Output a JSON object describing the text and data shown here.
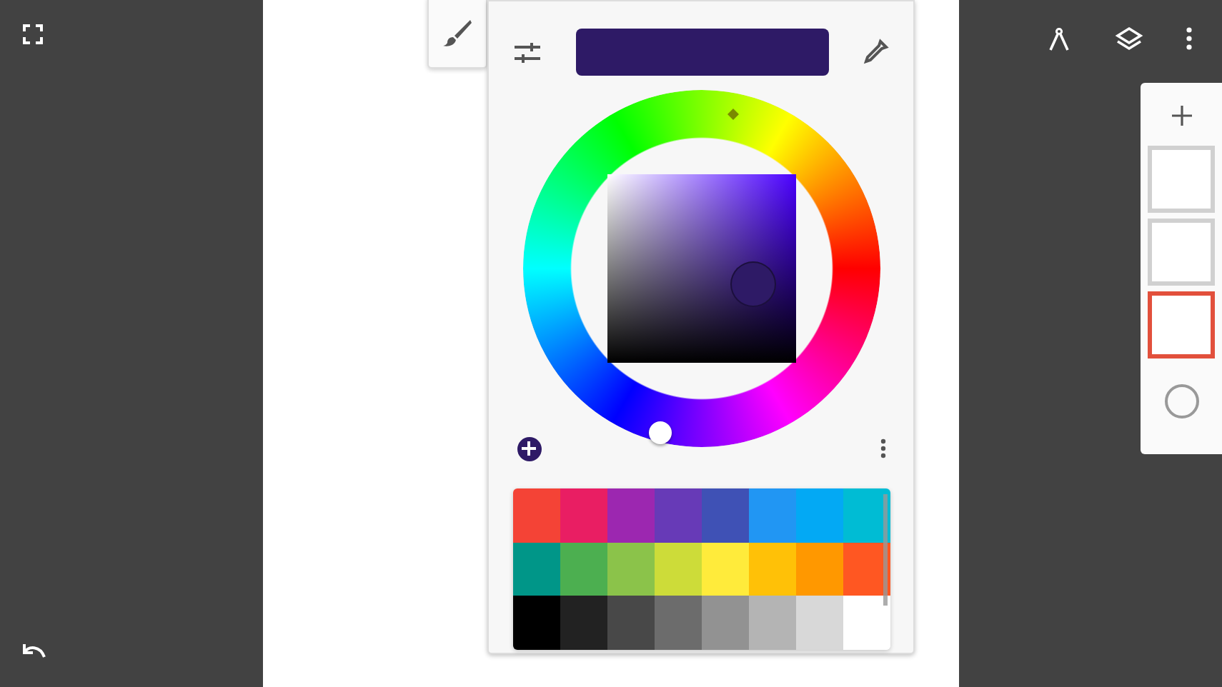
{
  "color_picker": {
    "current_color": {
      "color": "#2e1a66"
    },
    "hue": {
      "color": "#4a00ff"
    },
    "swatches": [
      {
        "color": "#f44336"
      },
      {
        "color": "#e91e63"
      },
      {
        "color": "#9c27b0"
      },
      {
        "color": "#673ab7"
      },
      {
        "color": "#3f51b5"
      },
      {
        "color": "#2196f3"
      },
      {
        "color": "#03a9f4"
      },
      {
        "color": "#00bcd4"
      },
      {
        "color": "#009688"
      },
      {
        "color": "#4caf50"
      },
      {
        "color": "#8bc34a"
      },
      {
        "color": "#cddc39"
      },
      {
        "color": "#ffeb3b"
      },
      {
        "color": "#ffc107"
      },
      {
        "color": "#ff9800"
      },
      {
        "color": "#ff5722"
      },
      {
        "color": "#000000"
      },
      {
        "color": "#222222"
      },
      {
        "color": "#484848"
      },
      {
        "color": "#6c6c6c"
      },
      {
        "color": "#929292"
      },
      {
        "color": "#b4b4b4"
      },
      {
        "color": "#d8d8d8"
      },
      {
        "color": "#ffffff"
      }
    ]
  },
  "layers": [
    {
      "selected": false
    },
    {
      "selected": false
    },
    {
      "selected": true
    }
  ]
}
